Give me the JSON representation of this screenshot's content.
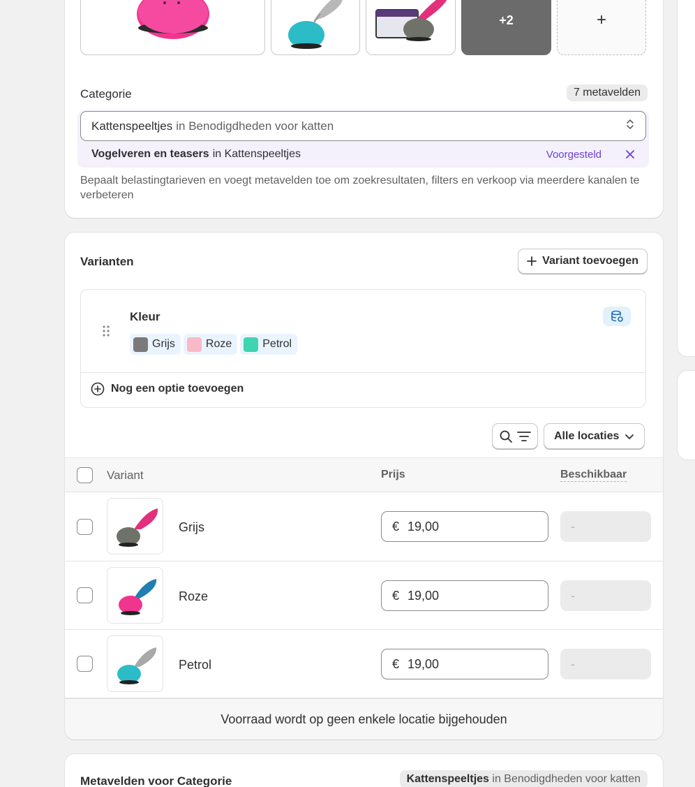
{
  "media": {
    "more_label": "+2",
    "add_label": "+"
  },
  "category": {
    "label": "Categorie",
    "metafields_badge": "7 metavelden",
    "selected_name": "Kattenspeeltjes",
    "selected_path": "in Benodigdheden voor katten",
    "suggestion_name": "Vogelveren en teasers",
    "suggestion_path": "in Kattenspeeltjes",
    "suggestion_tag": "Voorgesteld",
    "help_text": "Bepaalt belastingtarieven en voegt metavelden toe om zoekresultaten, filters en verkoop via meerdere kanalen te verbeteren"
  },
  "variants": {
    "title": "Varianten",
    "add_button": "Variant toevoegen",
    "option": {
      "name": "Kleur",
      "values": [
        {
          "label": "Grijs",
          "color": "#7a7a7a"
        },
        {
          "label": "Roze",
          "color": "#f9b9c6"
        },
        {
          "label": "Petrol",
          "color": "#3fd4b3"
        }
      ]
    },
    "add_option": "Nog een optie toevoegen",
    "location_select": "Alle locaties",
    "table": {
      "col_variant": "Variant",
      "col_price": "Prijs",
      "col_available": "Beschikbaar",
      "rows": [
        {
          "name": "Grijs",
          "currency": "€",
          "price": "19,00",
          "available": "-"
        },
        {
          "name": "Roze",
          "currency": "€",
          "price": "19,00",
          "available": "-"
        },
        {
          "name": "Petrol",
          "currency": "€",
          "price": "19,00",
          "available": "-"
        }
      ]
    },
    "stock_note": "Voorraad wordt op geen enkele locatie bijgehouden"
  },
  "metafields": {
    "title": "Metavelden voor Categorie",
    "badge_name": "Kattenspeeltjes",
    "badge_path": "in Benodigdheden voor katten"
  },
  "colors": {
    "accent_purple": "#6c3fd9",
    "pink_toy": "#f0358f",
    "teal_toy": "#2cbcc8",
    "grey_toy": "#6f7268"
  }
}
